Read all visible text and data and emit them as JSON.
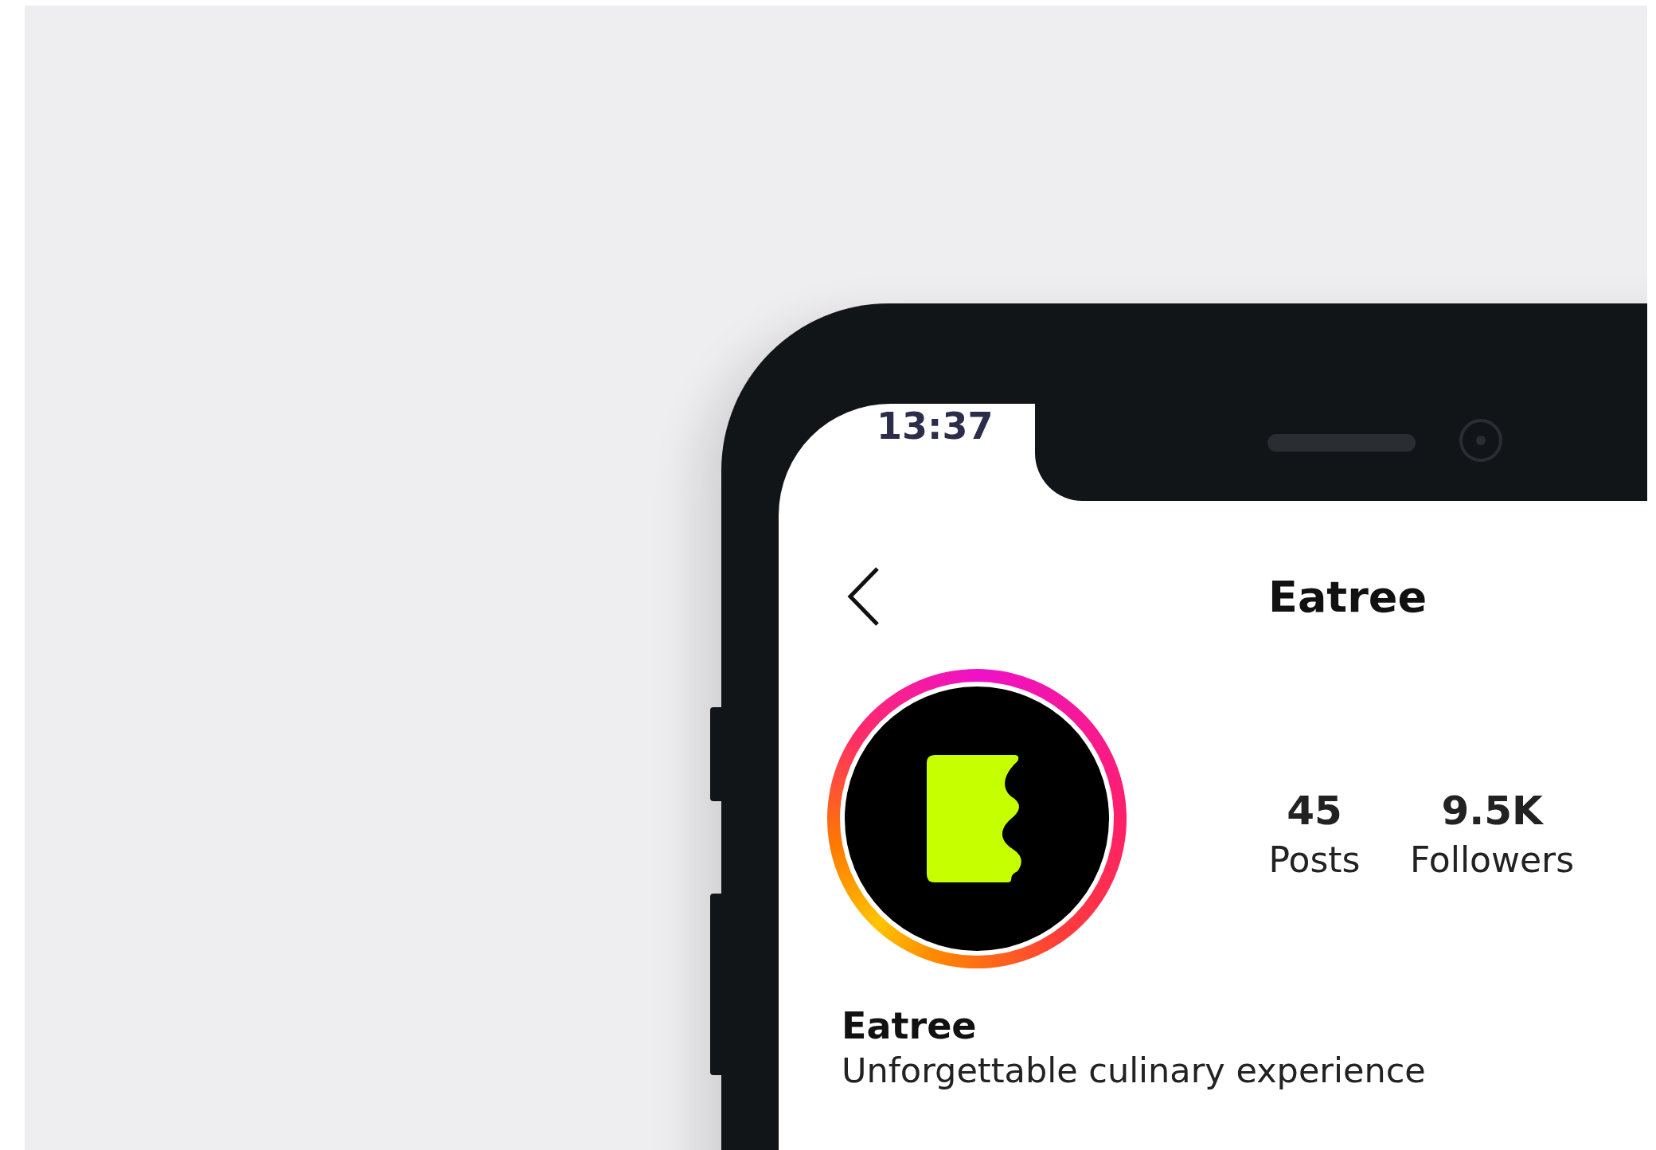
{
  "status_bar": {
    "time": "13:37"
  },
  "header": {
    "title": "Eatree"
  },
  "profile": {
    "name": "Eatree",
    "bio": "Unforgettable culinary experience",
    "stats": [
      {
        "value": "45",
        "label": "Posts"
      },
      {
        "value": "9.5K",
        "label": "Followers"
      }
    ]
  }
}
